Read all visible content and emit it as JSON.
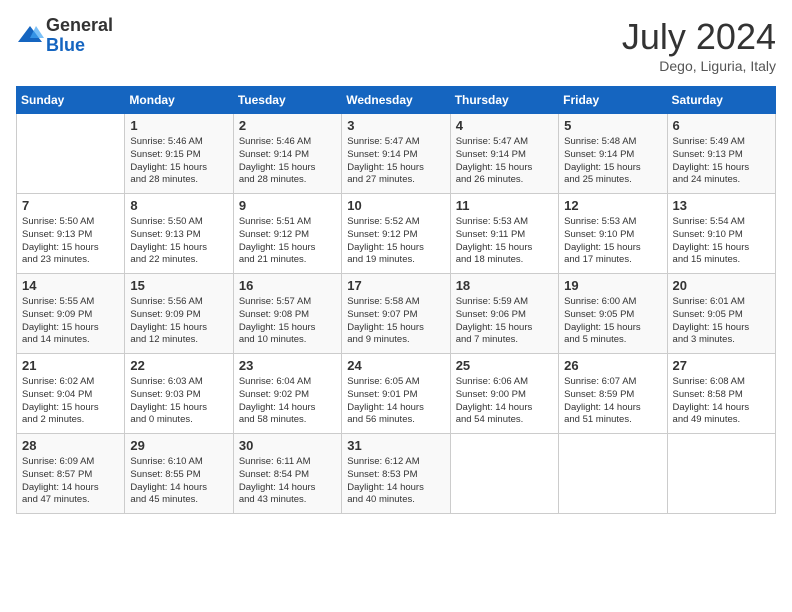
{
  "logo": {
    "general": "General",
    "blue": "Blue"
  },
  "title": "July 2024",
  "location": "Dego, Liguria, Italy",
  "days_of_week": [
    "Sunday",
    "Monday",
    "Tuesday",
    "Wednesday",
    "Thursday",
    "Friday",
    "Saturday"
  ],
  "weeks": [
    [
      {
        "day": "",
        "info": ""
      },
      {
        "day": "1",
        "info": "Sunrise: 5:46 AM\nSunset: 9:15 PM\nDaylight: 15 hours\nand 28 minutes."
      },
      {
        "day": "2",
        "info": "Sunrise: 5:46 AM\nSunset: 9:14 PM\nDaylight: 15 hours\nand 28 minutes."
      },
      {
        "day": "3",
        "info": "Sunrise: 5:47 AM\nSunset: 9:14 PM\nDaylight: 15 hours\nand 27 minutes."
      },
      {
        "day": "4",
        "info": "Sunrise: 5:47 AM\nSunset: 9:14 PM\nDaylight: 15 hours\nand 26 minutes."
      },
      {
        "day": "5",
        "info": "Sunrise: 5:48 AM\nSunset: 9:14 PM\nDaylight: 15 hours\nand 25 minutes."
      },
      {
        "day": "6",
        "info": "Sunrise: 5:49 AM\nSunset: 9:13 PM\nDaylight: 15 hours\nand 24 minutes."
      }
    ],
    [
      {
        "day": "7",
        "info": "Sunrise: 5:50 AM\nSunset: 9:13 PM\nDaylight: 15 hours\nand 23 minutes."
      },
      {
        "day": "8",
        "info": "Sunrise: 5:50 AM\nSunset: 9:13 PM\nDaylight: 15 hours\nand 22 minutes."
      },
      {
        "day": "9",
        "info": "Sunrise: 5:51 AM\nSunset: 9:12 PM\nDaylight: 15 hours\nand 21 minutes."
      },
      {
        "day": "10",
        "info": "Sunrise: 5:52 AM\nSunset: 9:12 PM\nDaylight: 15 hours\nand 19 minutes."
      },
      {
        "day": "11",
        "info": "Sunrise: 5:53 AM\nSunset: 9:11 PM\nDaylight: 15 hours\nand 18 minutes."
      },
      {
        "day": "12",
        "info": "Sunrise: 5:53 AM\nSunset: 9:10 PM\nDaylight: 15 hours\nand 17 minutes."
      },
      {
        "day": "13",
        "info": "Sunrise: 5:54 AM\nSunset: 9:10 PM\nDaylight: 15 hours\nand 15 minutes."
      }
    ],
    [
      {
        "day": "14",
        "info": "Sunrise: 5:55 AM\nSunset: 9:09 PM\nDaylight: 15 hours\nand 14 minutes."
      },
      {
        "day": "15",
        "info": "Sunrise: 5:56 AM\nSunset: 9:09 PM\nDaylight: 15 hours\nand 12 minutes."
      },
      {
        "day": "16",
        "info": "Sunrise: 5:57 AM\nSunset: 9:08 PM\nDaylight: 15 hours\nand 10 minutes."
      },
      {
        "day": "17",
        "info": "Sunrise: 5:58 AM\nSunset: 9:07 PM\nDaylight: 15 hours\nand 9 minutes."
      },
      {
        "day": "18",
        "info": "Sunrise: 5:59 AM\nSunset: 9:06 PM\nDaylight: 15 hours\nand 7 minutes."
      },
      {
        "day": "19",
        "info": "Sunrise: 6:00 AM\nSunset: 9:05 PM\nDaylight: 15 hours\nand 5 minutes."
      },
      {
        "day": "20",
        "info": "Sunrise: 6:01 AM\nSunset: 9:05 PM\nDaylight: 15 hours\nand 3 minutes."
      }
    ],
    [
      {
        "day": "21",
        "info": "Sunrise: 6:02 AM\nSunset: 9:04 PM\nDaylight: 15 hours\nand 2 minutes."
      },
      {
        "day": "22",
        "info": "Sunrise: 6:03 AM\nSunset: 9:03 PM\nDaylight: 15 hours\nand 0 minutes."
      },
      {
        "day": "23",
        "info": "Sunrise: 6:04 AM\nSunset: 9:02 PM\nDaylight: 14 hours\nand 58 minutes."
      },
      {
        "day": "24",
        "info": "Sunrise: 6:05 AM\nSunset: 9:01 PM\nDaylight: 14 hours\nand 56 minutes."
      },
      {
        "day": "25",
        "info": "Sunrise: 6:06 AM\nSunset: 9:00 PM\nDaylight: 14 hours\nand 54 minutes."
      },
      {
        "day": "26",
        "info": "Sunrise: 6:07 AM\nSunset: 8:59 PM\nDaylight: 14 hours\nand 51 minutes."
      },
      {
        "day": "27",
        "info": "Sunrise: 6:08 AM\nSunset: 8:58 PM\nDaylight: 14 hours\nand 49 minutes."
      }
    ],
    [
      {
        "day": "28",
        "info": "Sunrise: 6:09 AM\nSunset: 8:57 PM\nDaylight: 14 hours\nand 47 minutes."
      },
      {
        "day": "29",
        "info": "Sunrise: 6:10 AM\nSunset: 8:55 PM\nDaylight: 14 hours\nand 45 minutes."
      },
      {
        "day": "30",
        "info": "Sunrise: 6:11 AM\nSunset: 8:54 PM\nDaylight: 14 hours\nand 43 minutes."
      },
      {
        "day": "31",
        "info": "Sunrise: 6:12 AM\nSunset: 8:53 PM\nDaylight: 14 hours\nand 40 minutes."
      },
      {
        "day": "",
        "info": ""
      },
      {
        "day": "",
        "info": ""
      },
      {
        "day": "",
        "info": ""
      }
    ]
  ]
}
